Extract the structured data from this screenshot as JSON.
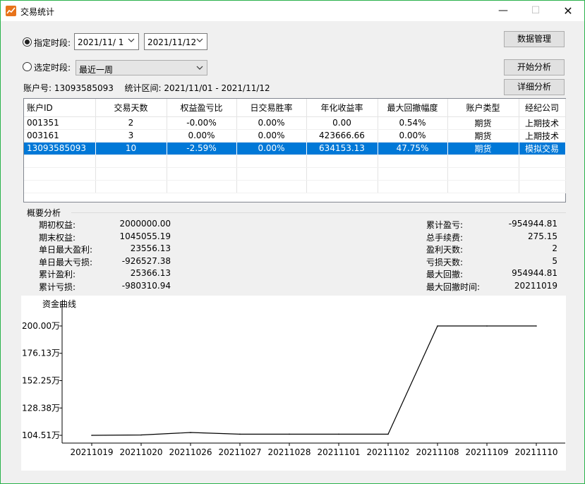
{
  "window": {
    "title": "交易统计",
    "accent": "#2bb24c"
  },
  "filters": {
    "fixed_period_label": "指定时段:",
    "start_date": "2021/11/ 1",
    "end_date": "2021/11/12",
    "preset_period_label": "选定时段:",
    "preset_value": "最近一周",
    "fixed_period_selected": true
  },
  "buttons": {
    "data_manage": "数据管理",
    "start_analysis": "开始分析",
    "detail_analysis": "详细分析"
  },
  "info": {
    "account_label": "账户号:",
    "account_value": "13093585093",
    "range_label": "统计区间:",
    "range_value": "2021/11/01 - 2021/11/12"
  },
  "table": {
    "columns": [
      "账户ID",
      "交易天数",
      "权益盈亏比",
      "日交易胜率",
      "年化收益率",
      "最大回撤幅度",
      "账户类型",
      "经纪公司"
    ],
    "rows": [
      [
        "001351",
        "2",
        "-0.00%",
        "0.00%",
        "0.00",
        "0.54%",
        "期货",
        "上期技术"
      ],
      [
        "003161",
        "3",
        "0.00%",
        "0.00%",
        "423666.66",
        "0.00%",
        "期货",
        "上期技术"
      ],
      [
        "13093585093",
        "10",
        "-2.59%",
        "0.00%",
        "634153.13",
        "47.75%",
        "期货",
        "模拟交易"
      ]
    ],
    "selected_row": 2,
    "selection_color": "#0078d7"
  },
  "summary": {
    "title": "概要分析",
    "left": [
      {
        "label": "期初权益:",
        "value": "2000000.00"
      },
      {
        "label": "期末权益:",
        "value": "1045055.19"
      },
      {
        "label": "单日最大盈利:",
        "value": "23556.13"
      },
      {
        "label": "单日最大亏损:",
        "value": "-926527.38"
      },
      {
        "label": "累计盈利:",
        "value": "25366.13"
      },
      {
        "label": "累计亏损:",
        "value": "-980310.94"
      }
    ],
    "right": [
      {
        "label": "累计盈亏:",
        "value": "-954944.81"
      },
      {
        "label": "总手续费:",
        "value": "275.15"
      },
      {
        "label": "盈利天数:",
        "value": "2"
      },
      {
        "label": "亏损天数:",
        "value": "5"
      },
      {
        "label": "最大回撤:",
        "value": "954944.81"
      },
      {
        "label": "最大回撤时间:",
        "value": "20211019"
      }
    ]
  },
  "chart_data": {
    "type": "line",
    "title": "资金曲线",
    "categories": [
      "20211019",
      "20211020",
      "20211026",
      "20211027",
      "20211028",
      "20211101",
      "20211102",
      "20211108",
      "20211109",
      "20211110"
    ],
    "series": [
      {
        "values": [
          104.5,
          104.8,
          107.0,
          105.5,
          105.5,
          105.5,
          105.5,
          200.0,
          200.0,
          200.0
        ]
      }
    ],
    "yticks": [
      "200.00万",
      "176.13万",
      "152.25万",
      "128.38万",
      "104.51万"
    ],
    "ytick_values": [
      200.0,
      176.13,
      152.25,
      128.38,
      104.51
    ],
    "ylim": [
      104.51,
      200.0
    ],
    "grid": false,
    "line_color": "#000000"
  }
}
